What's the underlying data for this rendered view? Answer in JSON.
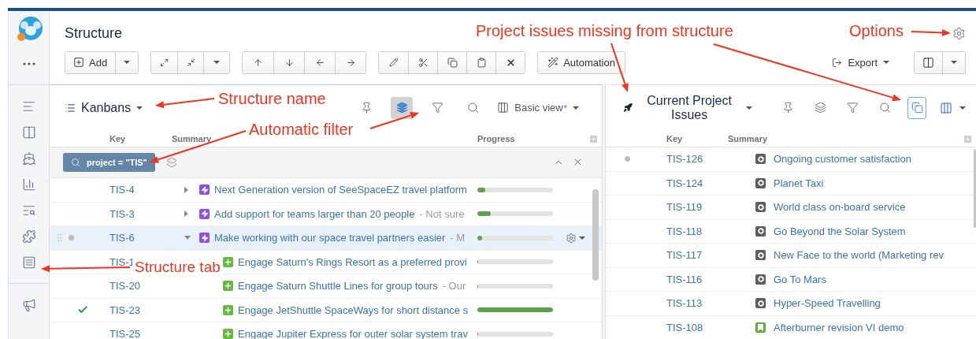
{
  "header": {
    "title": "Structure",
    "toolbar": {
      "add_label": "Add",
      "automation_label": "Automation",
      "export_label": "Export"
    }
  },
  "left_panel": {
    "title": "Kanbans",
    "tools": [
      {
        "kind": "pin",
        "selected": false
      },
      {
        "kind": "layers",
        "selected": true
      },
      {
        "kind": "filter",
        "selected": false
      },
      {
        "kind": "search",
        "selected": false
      }
    ],
    "view": {
      "label": "Basic view",
      "modified_mark": "*"
    },
    "columns": [
      "Key",
      "Summary",
      "Progress"
    ],
    "filter_chip": "project = \"TIS\"",
    "rows": [
      {
        "key": "TIS-4",
        "kind": "epic",
        "summary": "Next Generation version of SeeSpaceEZ travel platform",
        "expanded": false,
        "level": 0.1,
        "selected": false
      },
      {
        "key": "TIS-3",
        "kind": "epic",
        "summary": "Add support for teams larger than 20 people",
        "description": "- Not sure",
        "expanded": false,
        "level": 0.18,
        "selected": false
      },
      {
        "key": "TIS-6",
        "kind": "epic",
        "summary": "Make working with our space travel partners easier",
        "description": "- M",
        "marker": {
          "kind": "dot"
        },
        "expanded": true,
        "level": 0.06,
        "selected": true,
        "children": [
          {
            "key": "TIS-1",
            "kind": "feature",
            "summary": "Engage Saturn's Rings Resort as a preferred provi",
            "level": 0,
            "selected": false
          },
          {
            "key": "TIS-20",
            "kind": "feature",
            "summary": "Engage Saturn Shuttle Lines for group tours",
            "description": "- Our",
            "level": 0,
            "selected": false
          },
          {
            "key": "TIS-23",
            "kind": "feature",
            "summary": "Engage JetShuttle SpaceWays for short distance s",
            "marker": {
              "kind": "check"
            },
            "level": 1,
            "selected": false
          },
          {
            "key": "TIS-25",
            "kind": "feature",
            "summary": "Engage Jupiter Express for outer solar system trav",
            "level": 0,
            "selected": false
          }
        ]
      }
    ]
  },
  "right_panel": {
    "title": "Current Project Issues",
    "tools": [
      {
        "kind": "pin",
        "selected": false
      },
      {
        "kind": "layers",
        "selected": false
      },
      {
        "kind": "filter",
        "selected": false
      },
      {
        "kind": "search",
        "selected": false
      },
      {
        "kind": "missing",
        "selected": true
      }
    ],
    "columns": [
      "Key",
      "Summary"
    ],
    "rows": [
      {
        "key": "TIS-126",
        "kind": "task",
        "summary": "Ongoing customer satisfaction",
        "marker": {
          "kind": "dot"
        }
      },
      {
        "key": "TIS-124",
        "kind": "task",
        "summary": "Planet Taxi"
      },
      {
        "key": "TIS-119",
        "kind": "task",
        "summary": "World class on-board service"
      },
      {
        "key": "TIS-118",
        "kind": "task",
        "summary": "Go Beyond the Solar System"
      },
      {
        "key": "TIS-117",
        "kind": "task",
        "summary": "New Face to the world (Marketing rev"
      },
      {
        "key": "TIS-116",
        "kind": "task",
        "summary": "Go To Mars"
      },
      {
        "key": "TIS-113",
        "kind": "task",
        "summary": "Hyper-Speed Travelling"
      },
      {
        "key": "TIS-108",
        "kind": "story",
        "summary": "Afterburner revision VI demo"
      }
    ]
  },
  "annotations": [
    {
      "text": "Structure name"
    },
    {
      "text": "Automatic filter"
    },
    {
      "text": "Project issues missing from structure"
    },
    {
      "text": "Options"
    },
    {
      "text": "Structure tab"
    }
  ]
}
